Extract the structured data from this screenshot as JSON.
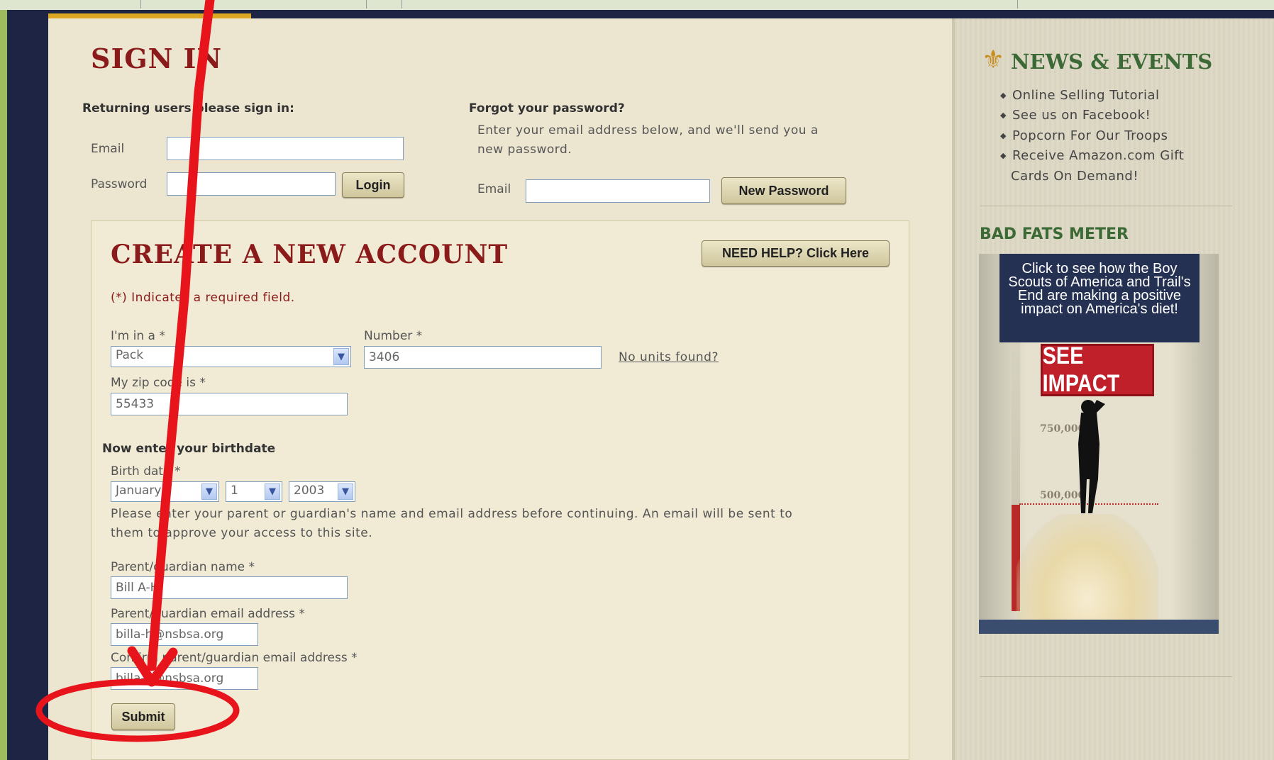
{
  "signin": {
    "title": "SIGN IN",
    "returning_label": "Returning users please sign in:",
    "email_label": "Email",
    "password_label": "Password",
    "email_value": "",
    "password_value": "",
    "login_button": "Login"
  },
  "forgot": {
    "title": "Forgot your password?",
    "description_line1": "Enter your email address below, and we'll send you a",
    "description_line2": "new password.",
    "email_label": "Email",
    "email_value": "",
    "new_password_button": "New Password"
  },
  "create": {
    "title": "CREATE A NEW ACCOUNT",
    "help_button": "NEED HELP? Click Here",
    "required_note": "(*) Indicates a required field.",
    "unit_type_label": "I'm in a *",
    "unit_type_value": "Pack",
    "number_label": "Number *",
    "number_value": "3406",
    "no_units_link": "No units found?",
    "zip_label": "My zip code is *",
    "zip_value": "55433",
    "birth_heading": "Now enter your birthdate",
    "birth_label": "Birth date *",
    "birth_month": "January",
    "birth_day": "1",
    "birth_year": "2003",
    "parent_note_line1": "Please enter your parent or guardian's name and email address before continuing. An email will be sent to",
    "parent_note_line2": "them to approve your access to this site.",
    "parent_name_label": "Parent/guardian name *",
    "parent_name_value": "Bill A-H",
    "parent_email_label": "Parent/guardian email address *",
    "parent_email_value": "billa-h@nsbsa.org",
    "confirm_email_label": "Confirm parent/guardian email address *",
    "confirm_email_value": "billa-h@nsbsa.org",
    "submit_button": "Submit"
  },
  "sidebar": {
    "news_title": "NEWS & EVENTS",
    "news_items": [
      "Online Selling Tutorial",
      "See us on Facebook!",
      "Popcorn For Our Troops",
      "Receive Amazon.com Gift",
      "Cards On Demand!"
    ],
    "bad_fats_title": "BAD FATS METER",
    "ad_text": "Click to see how the Boy Scouts of America and Trail's End are making a positive impact on America's diet!",
    "ad_button": "SEE IMPACT",
    "ad_tick_1": "750,000",
    "ad_tick_2": "500,000"
  },
  "annotation": {
    "color": "#e8141c"
  }
}
